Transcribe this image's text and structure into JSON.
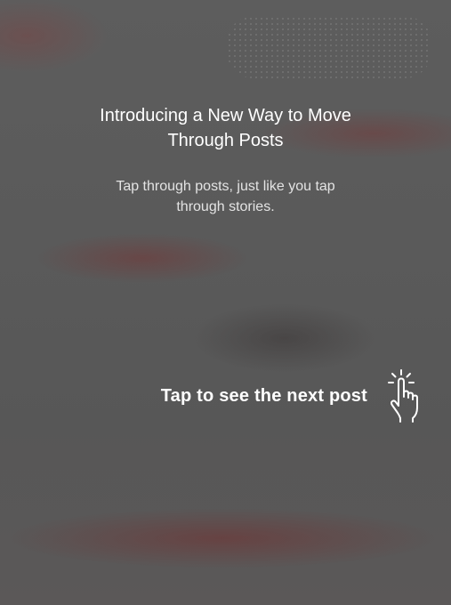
{
  "intro": {
    "title": "Introducing a New Way to Move Through Posts",
    "subtitle": "Tap through posts, just like you tap through stories."
  },
  "hint": {
    "label": "Tap to see the next post",
    "icon": "tap-hand-icon"
  },
  "colors": {
    "text_primary": "#ffffff",
    "text_secondary": "#e3e3e3",
    "overlay": "#5b5b5b"
  }
}
